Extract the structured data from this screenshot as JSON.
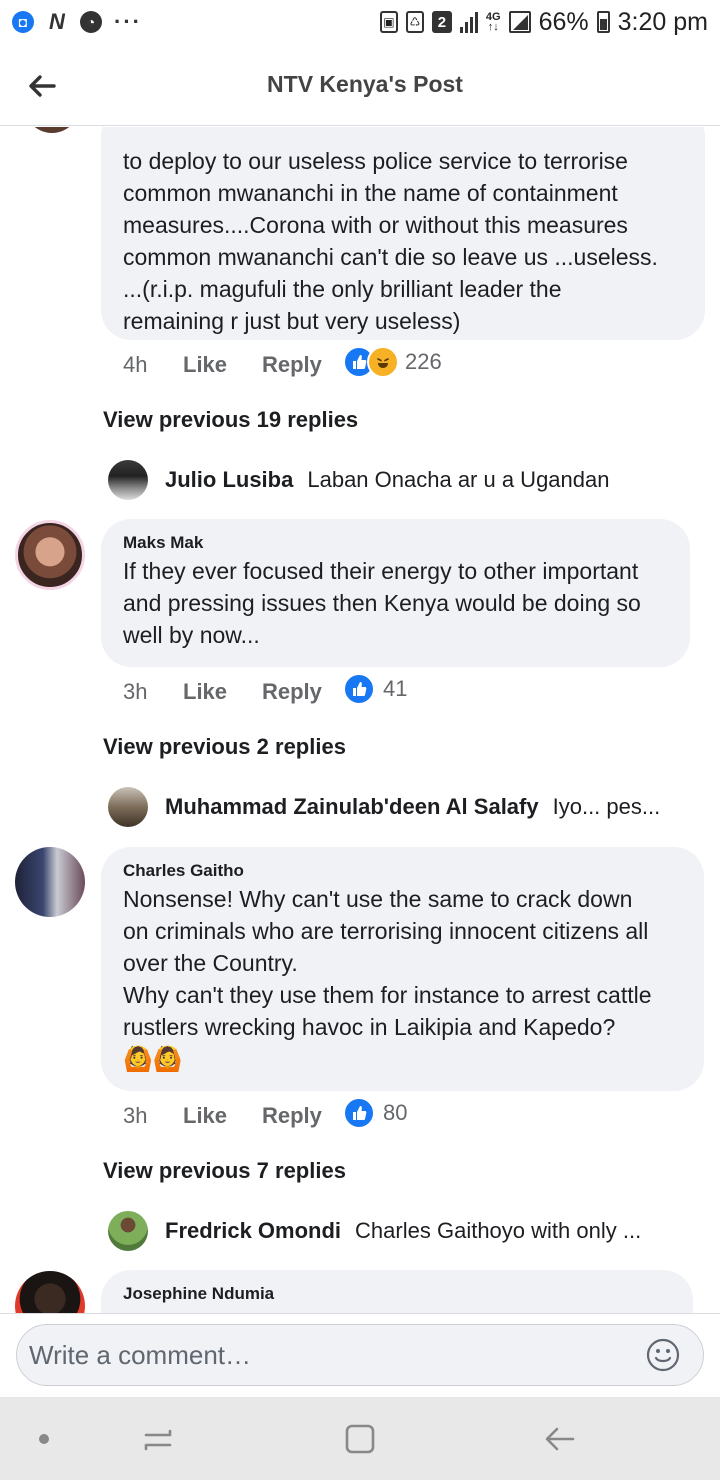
{
  "status_bar": {
    "battery": "66%",
    "time": "3:20 pm",
    "sim_badge": "2",
    "network": "4G"
  },
  "header": {
    "title": "NTV Kenya's Post"
  },
  "comments": [
    {
      "text_lines": [
        "to deploy to our useless police service to terrorise",
        "common mwananchi in the name of containment",
        "measures....Corona with or without this measures",
        "common mwananchi can't die so leave us ...useless.",
        "...(r.i.p. magufuli the only brilliant leader the",
        "remaining r just but very useless)"
      ],
      "time": "4h",
      "like_label": "Like",
      "reply_label": "Reply",
      "reaction_count": "226",
      "reactions": [
        "like-icon",
        "haha-icon"
      ],
      "view_previous": "View previous 19 replies",
      "latest_reply": {
        "name": "Julio Lusiba",
        "text": "Laban Onacha ar u a Ugandan"
      }
    },
    {
      "author": "Maks Mak",
      "text_lines": [
        "If they ever focused their energy to other important",
        "and pressing issues then Kenya would be doing so",
        "well by now..."
      ],
      "time": "3h",
      "like_label": "Like",
      "reply_label": "Reply",
      "reaction_count": "41",
      "reactions": [
        "like-icon"
      ],
      "view_previous": "View previous 2 replies",
      "latest_reply": {
        "name": "Muhammad Zainulab'deen Al Salafy",
        "text": "Iyo... pes..."
      }
    },
    {
      "author": "Charles Gaitho",
      "text_lines": [
        "Nonsense! Why can't use the same to crack down",
        "on criminals who are terrorising innocent citizens all",
        "over the Country.",
        "Why can't they use them for instance to arrest cattle",
        "rustlers wrecking havoc in Laikipia and Kapedo?"
      ],
      "emojis": "🙆🙆",
      "time": "3h",
      "like_label": "Like",
      "reply_label": "Reply",
      "reaction_count": "80",
      "reactions": [
        "like-icon"
      ],
      "view_previous": "View previous 7 replies",
      "latest_reply": {
        "name": "Fredrick Omondi",
        "text": "Charles Gaithoyo  with only ..."
      }
    },
    {
      "author": "Josephine Ndumia"
    }
  ],
  "composer": {
    "placeholder": "Write a comment…",
    "emoji_icon": "smiley-icon"
  },
  "colors": {
    "facebook_blue": "#1877f2",
    "bubble_bg": "#f0f2f5",
    "meta_gray": "#65676b",
    "haha_yellow": "#f7b125"
  }
}
